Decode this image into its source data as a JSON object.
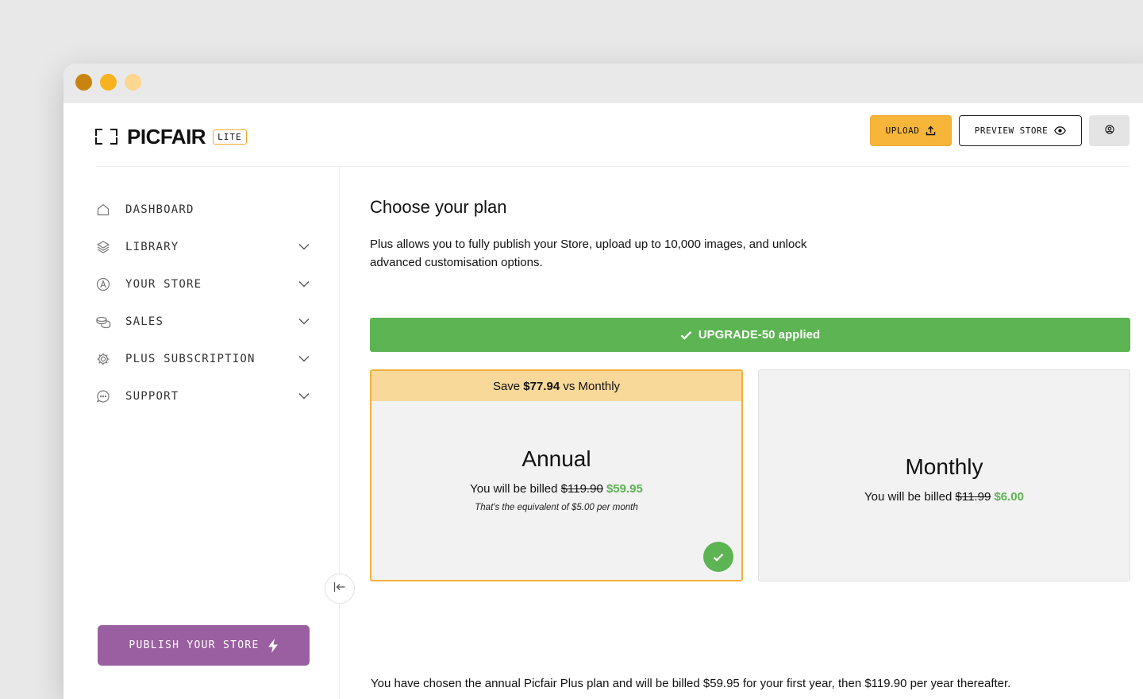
{
  "window": {
    "title": ""
  },
  "brand": {
    "name": "PICFAIR",
    "badge": "LITE"
  },
  "header": {
    "upload_label": "UPLOAD",
    "preview_label": "PREVIEW STORE",
    "account_icon": "account-icon"
  },
  "sidebar": {
    "items": [
      {
        "label": "DASHBOARD",
        "icon": "home-icon",
        "expandable": false
      },
      {
        "label": "LIBRARY",
        "icon": "layers-icon",
        "expandable": true
      },
      {
        "label": "YOUR STORE",
        "icon": "store-icon",
        "expandable": true
      },
      {
        "label": "SALES",
        "icon": "coins-icon",
        "expandable": true
      },
      {
        "label": "PLUS SUBSCRIPTION",
        "icon": "gear-icon",
        "expandable": true
      },
      {
        "label": "SUPPORT",
        "icon": "chat-icon",
        "expandable": true
      }
    ],
    "publish_label": "PUBLISH YOUR STORE"
  },
  "main": {
    "title": "Choose your plan",
    "description": "Plus allows you to fully publish your Store, upload up to 10,000 images, and unlock advanced customisation options.",
    "promo": "UPGRADE-50 applied",
    "plans": {
      "annual": {
        "save_prefix": "Save ",
        "save_amount": "$77.94",
        "save_suffix": " vs Monthly",
        "name": "Annual",
        "billed_prefix": "You will be billed ",
        "old_price": "$119.90",
        "new_price": "$59.95",
        "equivalent": "That's the equivalent of $5.00 per month",
        "selected": true
      },
      "monthly": {
        "name": "Monthly",
        "billed_prefix": "You will be billed ",
        "old_price": "$11.99",
        "new_price": "$6.00",
        "selected": false
      }
    },
    "summary": "You have chosen the annual Picfair Plus plan and will be billed $59.95 for your first year, then $119.90 per year thereafter."
  },
  "colors": {
    "accent": "#f7b53a",
    "success": "#5cb452",
    "publish": "#9a5fa0",
    "save_banner": "#f8d99a"
  }
}
